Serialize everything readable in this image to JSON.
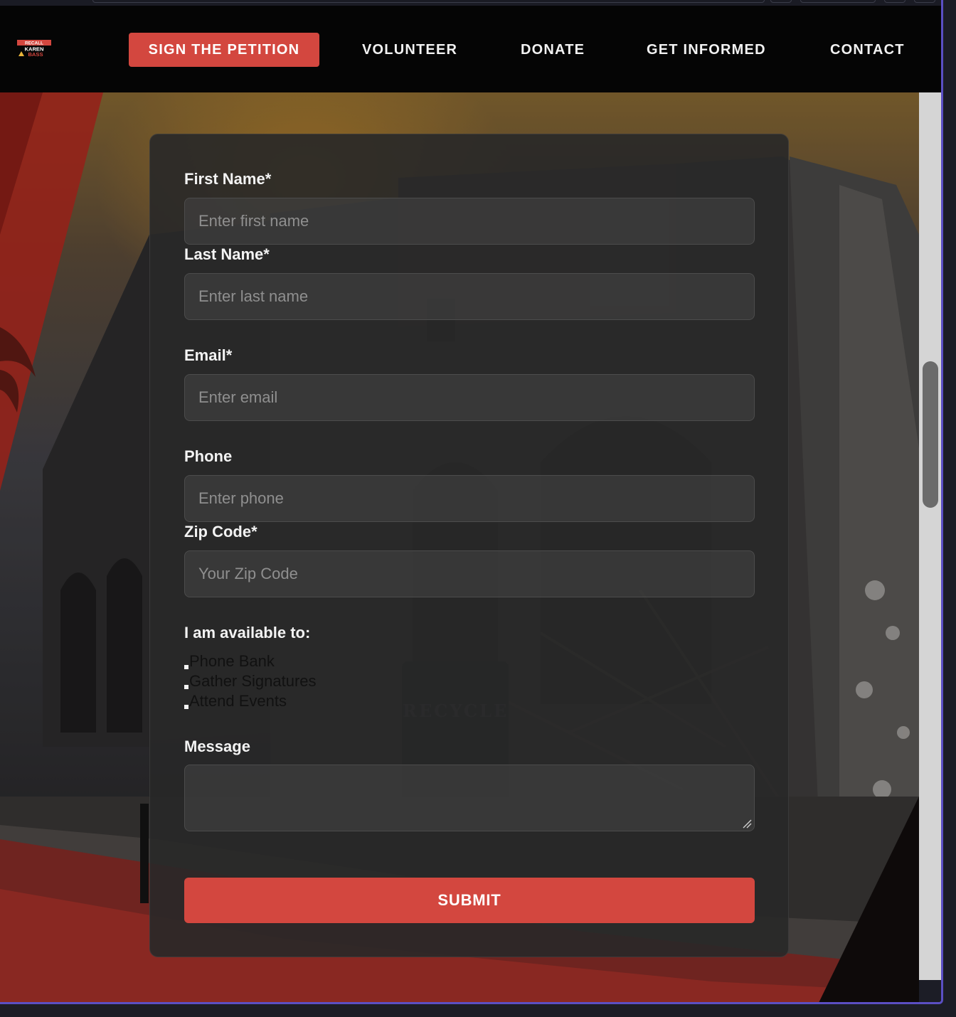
{
  "browser": {},
  "nav": {
    "logo_text": [
      "RECALL",
      "KAREN",
      "BASS"
    ],
    "items": [
      {
        "label": "SIGN THE PETITION"
      },
      {
        "label": "VOLUNTEER"
      },
      {
        "label": "DONATE"
      },
      {
        "label": "GET INFORMED"
      },
      {
        "label": "CONTACT"
      }
    ]
  },
  "form": {
    "first_name": {
      "label": "First Name*",
      "placeholder": "Enter first name",
      "value": ""
    },
    "last_name": {
      "label": "Last Name*",
      "placeholder": "Enter last name",
      "value": ""
    },
    "email": {
      "label": "Email*",
      "placeholder": "Enter email",
      "value": ""
    },
    "phone": {
      "label": "Phone",
      "placeholder": "Enter phone",
      "value": ""
    },
    "zip": {
      "label": "Zip Code*",
      "placeholder": "Your Zip Code",
      "value": ""
    },
    "availability": {
      "label": "I am available to:",
      "options": [
        "Phone Bank",
        "Gather Signatures",
        "Attend Events"
      ]
    },
    "message": {
      "label": "Message",
      "value": ""
    },
    "submit_label": "SUBMIT"
  },
  "colors": {
    "accent": "#d3473f",
    "navbar": "#050505",
    "card": "#282828",
    "window_border": "#5b4fc4"
  }
}
